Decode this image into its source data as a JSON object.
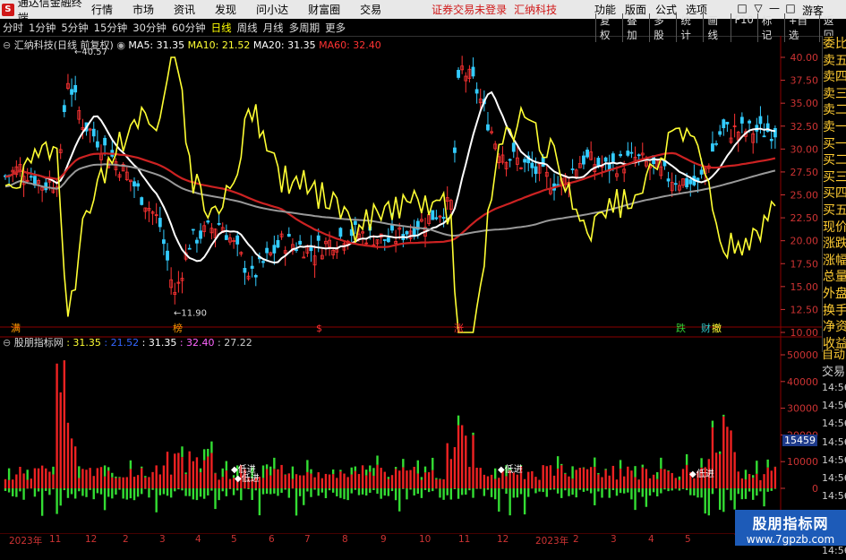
{
  "app": {
    "title": "通达信金融终端",
    "menu": [
      "行情",
      "市场",
      "资讯",
      "发现",
      "问小达",
      "财富圈",
      "交易"
    ],
    "notice": "证券交易未登录",
    "stock_name_top": "汇纳科技",
    "right_menu": [
      "功能",
      "版面",
      "公式",
      "选项"
    ],
    "guest": "游客",
    "win_controls": [
      "□",
      "▽",
      "—",
      "□",
      "×"
    ]
  },
  "timeframes": [
    "分时",
    "1分钟",
    "5分钟",
    "15分钟",
    "30分钟",
    "60分钟",
    "日线",
    "周线",
    "月线",
    "多周期",
    "更多"
  ],
  "active_timeframe": "日线",
  "tools": [
    "复权",
    "叠加",
    "多股",
    "统计",
    "画线",
    "F10",
    "标记",
    "+自选",
    "返回"
  ],
  "stock_header": "汇纳科技(日线 前复权)",
  "ma": [
    {
      "label": "MA5: 31.35",
      "color": "#ffffff"
    },
    {
      "label": "MA10: 21.52",
      "color": "#ffff33"
    },
    {
      "label": "MA20: 31.35",
      "color": "#ffffff"
    },
    {
      "label": "MA60: 32.40",
      "color": "#ff3333"
    }
  ],
  "price_axis": [
    "40.00",
    "37.50",
    "35.00",
    "32.50",
    "30.00",
    "27.50",
    "25.00",
    "22.50",
    "20.00",
    "17.50",
    "15.00",
    "12.50",
    "10.00"
  ],
  "high_label": "40.57",
  "low_label": "11.90",
  "event_labels": [
    {
      "text": "满",
      "color": "#ff9900"
    },
    {
      "text": "榜",
      "color": "#ff9900"
    },
    {
      "text": "$",
      "color": "#ff3333"
    },
    {
      "text": "涨",
      "color": "#ff3333"
    },
    {
      "text": "跌",
      "color": "#33cc33"
    },
    {
      "text": "财",
      "color": "#33cccc"
    },
    {
      "text": "撤",
      "color": "#ffff33"
    }
  ],
  "side_labels": [
    "委比",
    "卖五",
    "卖四",
    "卖三",
    "卖二",
    "卖一",
    "买一",
    "买二",
    "买三",
    "买四",
    "买五",
    "现价",
    "涨跌",
    "涨幅",
    "总量",
    "外盘",
    "换手",
    "净资",
    "收益"
  ],
  "side_auto": "自动",
  "side_trade": "交易",
  "side_times": [
    "14:56",
    "14:56",
    "14:56",
    "14:56",
    "14:56",
    "14:56",
    "14:56",
    "14:56",
    "14:56",
    "14:56"
  ],
  "indicator": {
    "title": "股朋指标网",
    "values": [
      {
        "label": ": 31.35",
        "color": "#ffff33"
      },
      {
        "label": ": 21.52",
        "color": "#3366ff"
      },
      {
        "label": ": 31.35",
        "color": "#ffffff"
      },
      {
        "label": ": 32.40",
        "color": "#ff66ff"
      },
      {
        "label": ": 27.22",
        "color": "#cccccc"
      }
    ],
    "axis": [
      "50000",
      "40000",
      "30000",
      "20000",
      "10000",
      "0"
    ],
    "marker": "15459",
    "signal_label": "低进"
  },
  "date_axis": [
    "2023年",
    "11",
    "12",
    "2",
    "3",
    "4",
    "5",
    "6",
    "7",
    "8",
    "9",
    "10",
    "11",
    "12",
    "2023年",
    "2",
    "3",
    "4",
    "5"
  ],
  "watermark": {
    "line1": "股朋指标网",
    "line2": "www.7gpzb.com"
  }
}
